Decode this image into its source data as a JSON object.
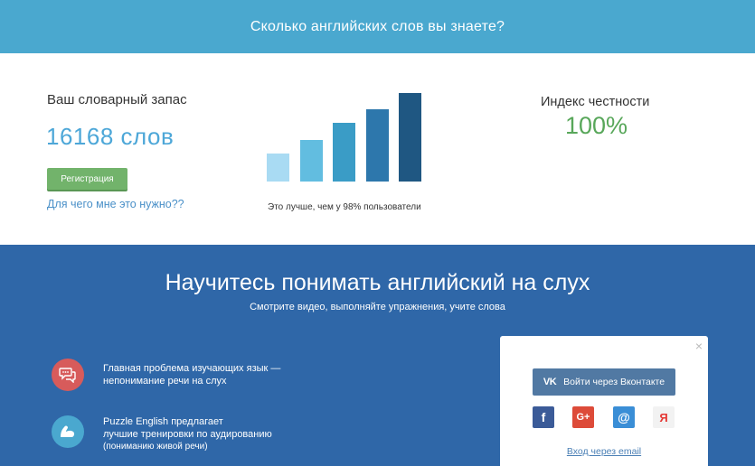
{
  "banner": {
    "title": "Сколько английских слов вы знаете?"
  },
  "result": {
    "vocab_label": "Ваш словарный запас",
    "vocab_value": "16168 слов",
    "register_label": "Регистрация",
    "why_link": "Для чего мне это нужно??",
    "honesty_label": "Индекс честности",
    "honesty_value": "100%",
    "comparison_text": "Это лучше, чем у 98% пользователи",
    "bar_colors": [
      "#a9dbf3",
      "#62bde0",
      "#3a9cc6",
      "#2d77ac",
      "#1f5782"
    ]
  },
  "promo": {
    "title": "Научитесь понимать английский на слух",
    "subtitle": "Смотрите видео, выполняйте упражнения, учите слова",
    "features": [
      {
        "icon": "speech-bubbles-icon",
        "line1": "Главная проблема изучающих язык —",
        "line2": "непонимание речи на слух"
      },
      {
        "icon": "muscle-arm-icon",
        "line1": "Puzzle English предлагает",
        "line2": "лучшие тренировки по аудированию",
        "line3": "(пониманию живой речи)"
      }
    ]
  },
  "login": {
    "close_icon": "×",
    "vk_logo": "VK",
    "vk_label": "Войти через Вконтакте",
    "facebook_glyph": "f",
    "google_glyph": "G+",
    "mail_glyph": "@",
    "yandex_glyph": "Я",
    "email_link": "Вход через email"
  }
}
